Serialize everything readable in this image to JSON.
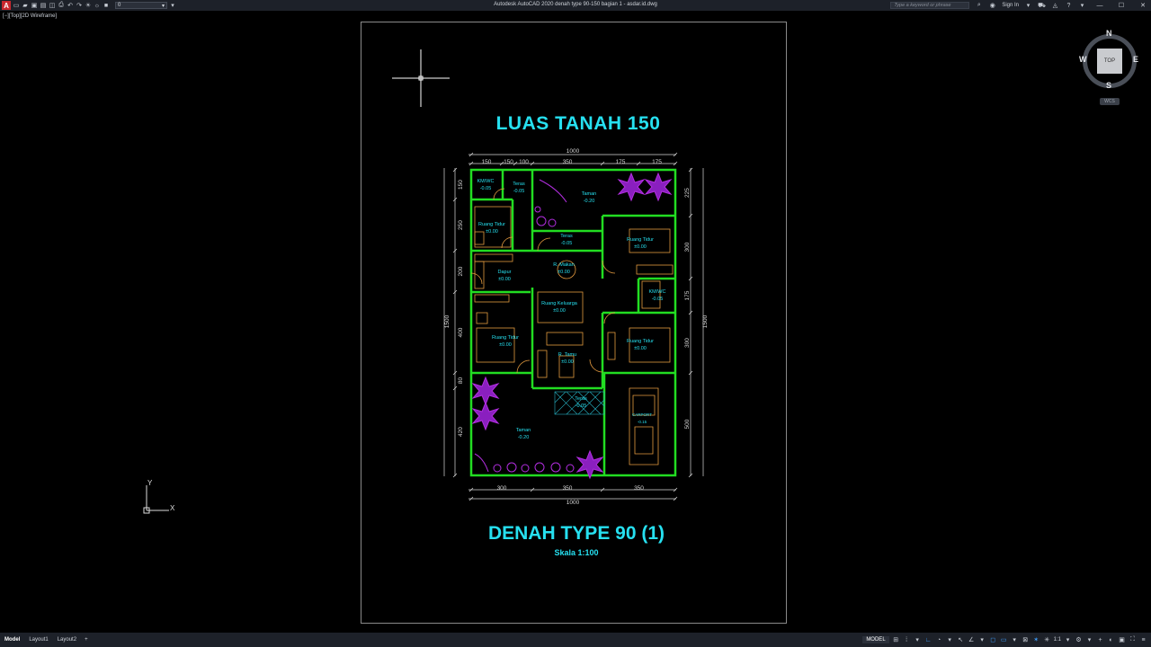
{
  "titlebar": {
    "app_title": "Autodesk AutoCAD 2020    denah type 90-150 bagian 1 - asdar.id.dwg",
    "layer_value": "0",
    "search_placeholder": "Type a keyword or phrase",
    "sign_in": "Sign In"
  },
  "viewport": {
    "label": "[−][Top][2D Wireframe]"
  },
  "navcube": {
    "top": "TOP",
    "n": "N",
    "s": "S",
    "e": "E",
    "w": "W",
    "wcs": "WCS"
  },
  "ucs": {
    "x": "X",
    "y": "Y"
  },
  "drawing": {
    "title_top": "LUAS TANAH 150",
    "title_bottom": "DENAH TYPE 90 (1)",
    "scale": "Skala  1:100",
    "dim_top_total": "1000",
    "dim_top": [
      "150",
      "150",
      "100",
      "350",
      "175",
      "175"
    ],
    "dim_bottom": [
      "300",
      "350",
      "350"
    ],
    "dim_bottom_total": "1000",
    "dim_left": [
      "150",
      "250",
      "200",
      "400",
      "80",
      "420"
    ],
    "dim_left_total": "1500",
    "dim_right": [
      "225",
      "300",
      "175",
      "300",
      "500"
    ],
    "dim_right_total": "1500",
    "rooms": [
      {
        "name": "KM/WC",
        "level": "-0.05"
      },
      {
        "name": "Teras",
        "level": "-0.05"
      },
      {
        "name": "Taman",
        "level": "-0.20"
      },
      {
        "name": "Ruang Tidur",
        "level": "±0.00"
      },
      {
        "name": "Teras",
        "level": "-0.05"
      },
      {
        "name": "Ruang Tidur",
        "level": "±0.00"
      },
      {
        "name": "Dapur",
        "level": "±0.00"
      },
      {
        "name": "R. Makan",
        "level": "±0.00"
      },
      {
        "name": "KM/WC",
        "level": "-0.05"
      },
      {
        "name": "Ruang Keluarga",
        "level": "±0.00"
      },
      {
        "name": "Ruang Tidur",
        "level": "±0.00"
      },
      {
        "name": "Ruang Tidur",
        "level": "±0.00"
      },
      {
        "name": "R. Tamu",
        "level": "±0.00"
      },
      {
        "name": "Teras",
        "level": "-0.05"
      },
      {
        "name": "CARPORT",
        "level": "-0.15"
      },
      {
        "name": "Taman",
        "level": "-0.20"
      }
    ]
  },
  "statusbar": {
    "tabs": [
      "Model",
      "Layout1",
      "Layout2"
    ],
    "add_tab": "+",
    "mode": "MODEL",
    "scale": "1:1"
  },
  "colors": {
    "background": "#000000",
    "wall": "#22dd22",
    "furniture": "#e39a3f",
    "text": "#26e0f0",
    "plant": "#b22ee0",
    "dimension": "#d8d8d8"
  }
}
